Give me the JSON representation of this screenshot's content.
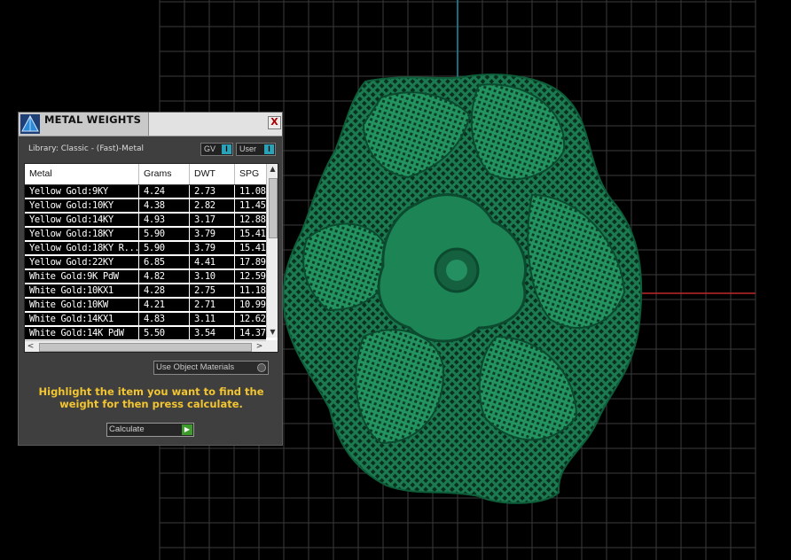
{
  "panel": {
    "title": "METAL WEIGHTS",
    "close_label": "X",
    "library_label": "Library: Classic - (Fast)-Metal",
    "toggles": [
      {
        "label": "GV",
        "knob": "I"
      },
      {
        "label": "User",
        "knob": "I"
      }
    ],
    "table": {
      "columns": [
        "Metal",
        "Grams",
        "DWT",
        "SPG"
      ],
      "rows": [
        [
          "Yellow Gold:9KY",
          "4.24",
          "2.73",
          "11.08"
        ],
        [
          "Yellow Gold:10KY",
          "4.38",
          "2.82",
          "11.45"
        ],
        [
          "Yellow Gold:14KY",
          "4.93",
          "3.17",
          "12.88"
        ],
        [
          "Yellow Gold:18KY",
          "5.90",
          "3.79",
          "15.41"
        ],
        [
          "Yellow Gold:18KY R...",
          "5.90",
          "3.79",
          "15.41"
        ],
        [
          "Yellow Gold:22KY",
          "6.85",
          "4.41",
          "17.89"
        ],
        [
          "White Gold:9K PdW",
          "4.82",
          "3.10",
          "12.59"
        ],
        [
          "White Gold:10KX1",
          "4.28",
          "2.75",
          "11.18"
        ],
        [
          "White Gold:10KW",
          "4.21",
          "2.71",
          "10.99"
        ],
        [
          "White Gold:14KX1",
          "4.83",
          "3.11",
          "12.62"
        ],
        [
          "White Gold:14K PdW",
          "5.50",
          "3.54",
          "14.37"
        ]
      ],
      "scroll_up": "▲",
      "scroll_down": "▼",
      "scroll_left": "<",
      "scroll_right": ">"
    },
    "object_materials_label": "Use Object Materials",
    "instruction": "Highlight the item you want to find the weight for then press calculate.",
    "calculate_label": "Calculate",
    "calculate_arrow": "▶"
  },
  "colors": {
    "background": "#000000",
    "grid_line": "#444444",
    "axis_vertical": "#1e8fa6",
    "axis_horizontal": "#c0282a",
    "model_green": "#1f8a5a",
    "instruction_text": "#f2c531"
  },
  "icons": {
    "logo": "pyramid-logo-icon",
    "close": "close-icon",
    "calculate": "play-arrow-icon"
  }
}
